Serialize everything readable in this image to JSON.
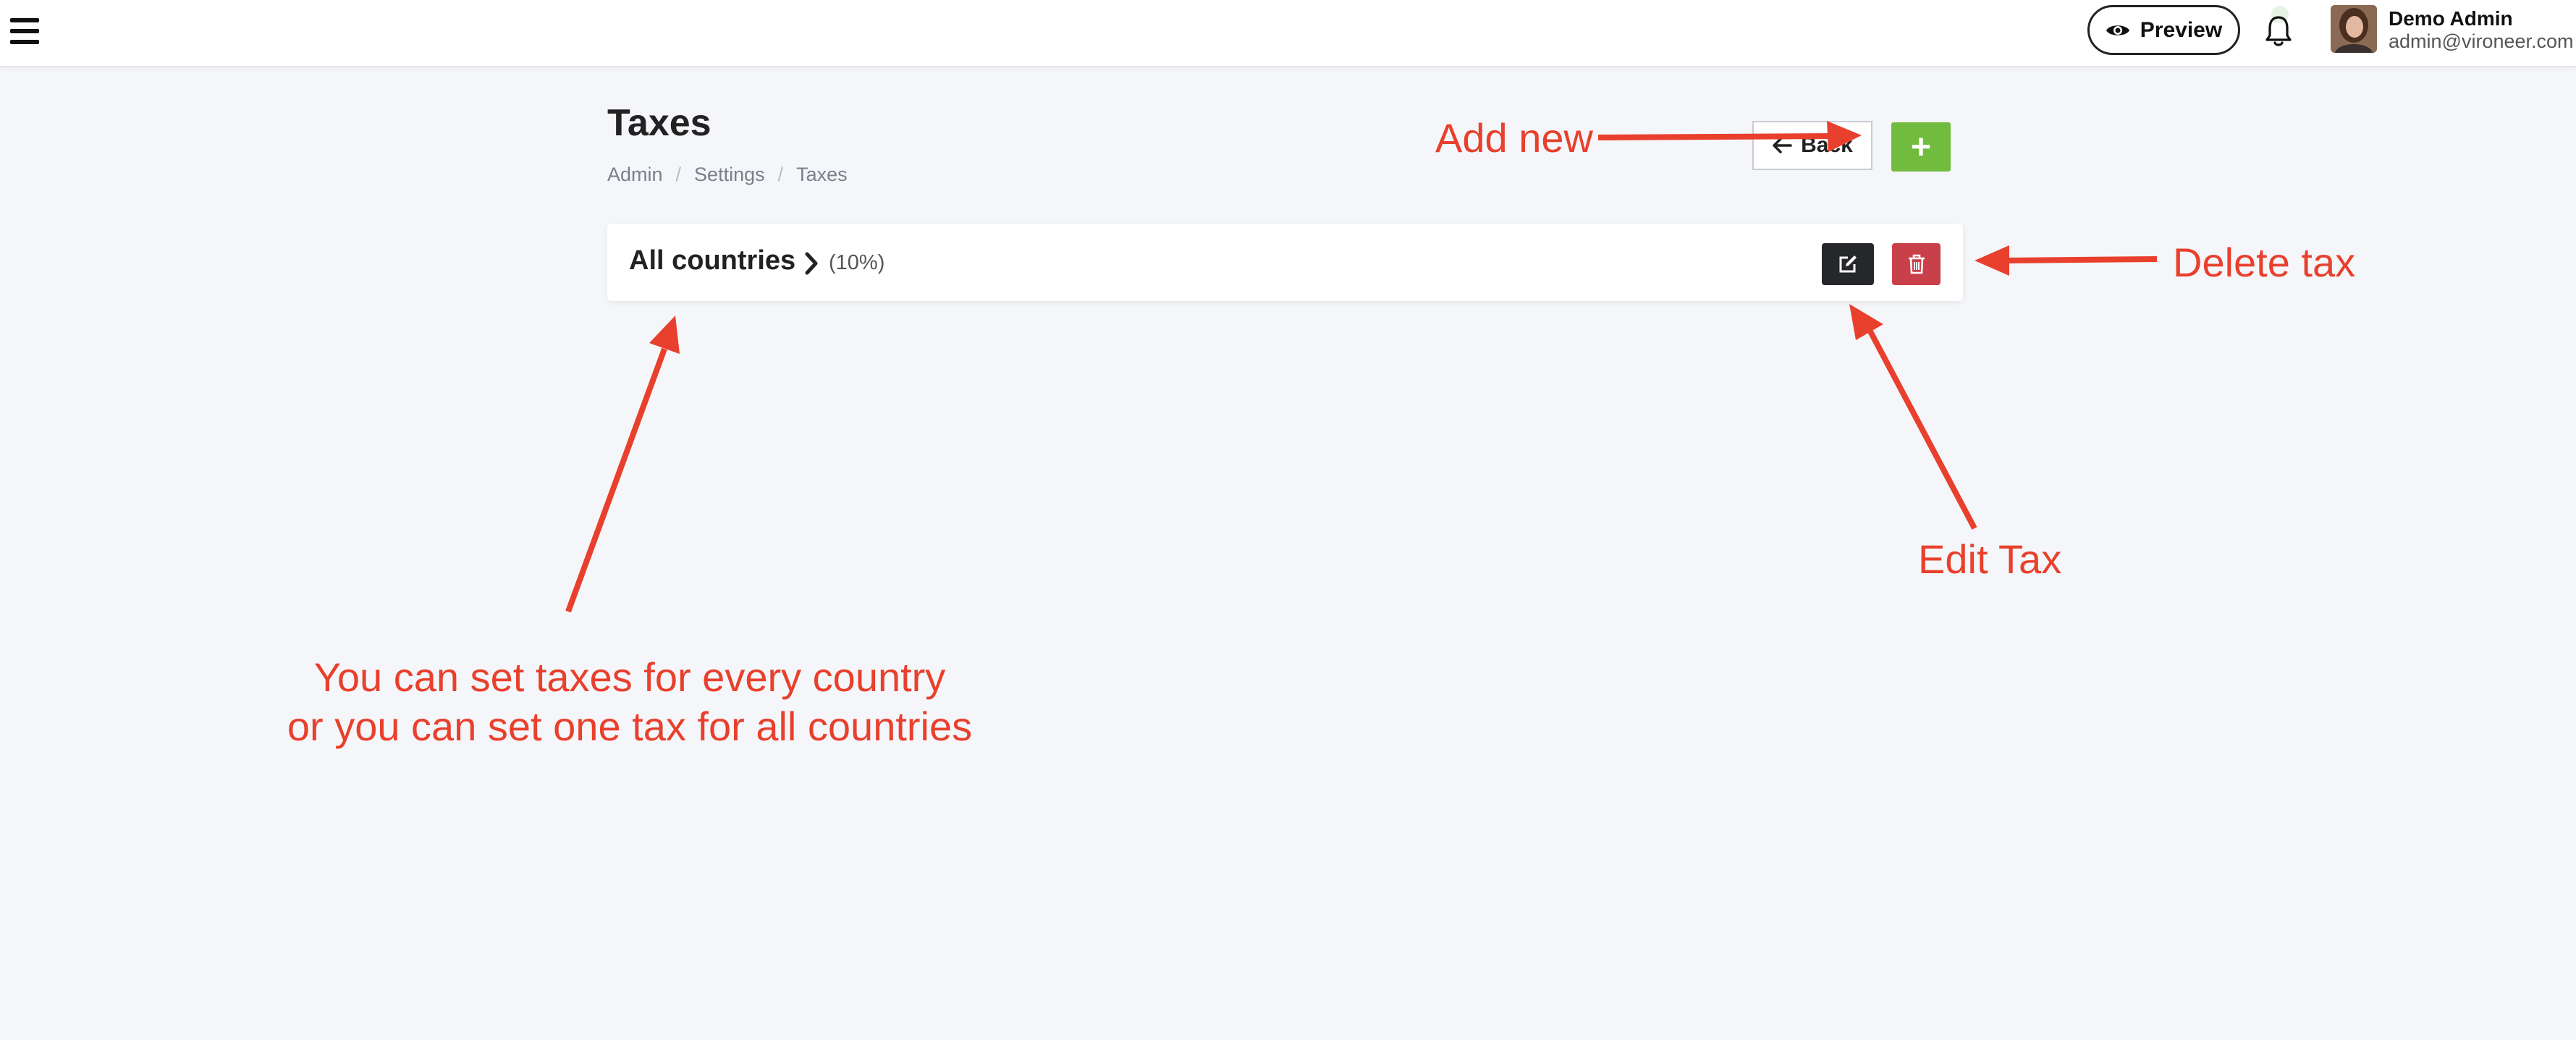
{
  "header": {
    "preview_label": "Preview",
    "user_name": "Demo Admin",
    "user_email": "admin@vironeer.com"
  },
  "page": {
    "title": "Taxes",
    "breadcrumb": [
      "Admin",
      "Settings",
      "Taxes"
    ],
    "back_label": "Back",
    "add_label": "+"
  },
  "taxes": [
    {
      "name": "All countries",
      "rate": "(10%)"
    }
  ],
  "annotations": {
    "add_new": "Add new",
    "delete_tax": "Delete tax",
    "edit_tax": "Edit Tax",
    "tip_line1": "You can set taxes for every country",
    "tip_line2": "or you can set one tax for all countries"
  },
  "colors": {
    "accent_green": "#71bb3e",
    "danger_red": "#c9404a",
    "dark": "#25272b",
    "annotation": "#e8402d"
  },
  "icons": [
    "menu-icon",
    "eye-icon",
    "bell-icon",
    "arrow-left-icon",
    "plus-icon",
    "chevron-right-icon",
    "edit-icon",
    "trash-icon"
  ]
}
